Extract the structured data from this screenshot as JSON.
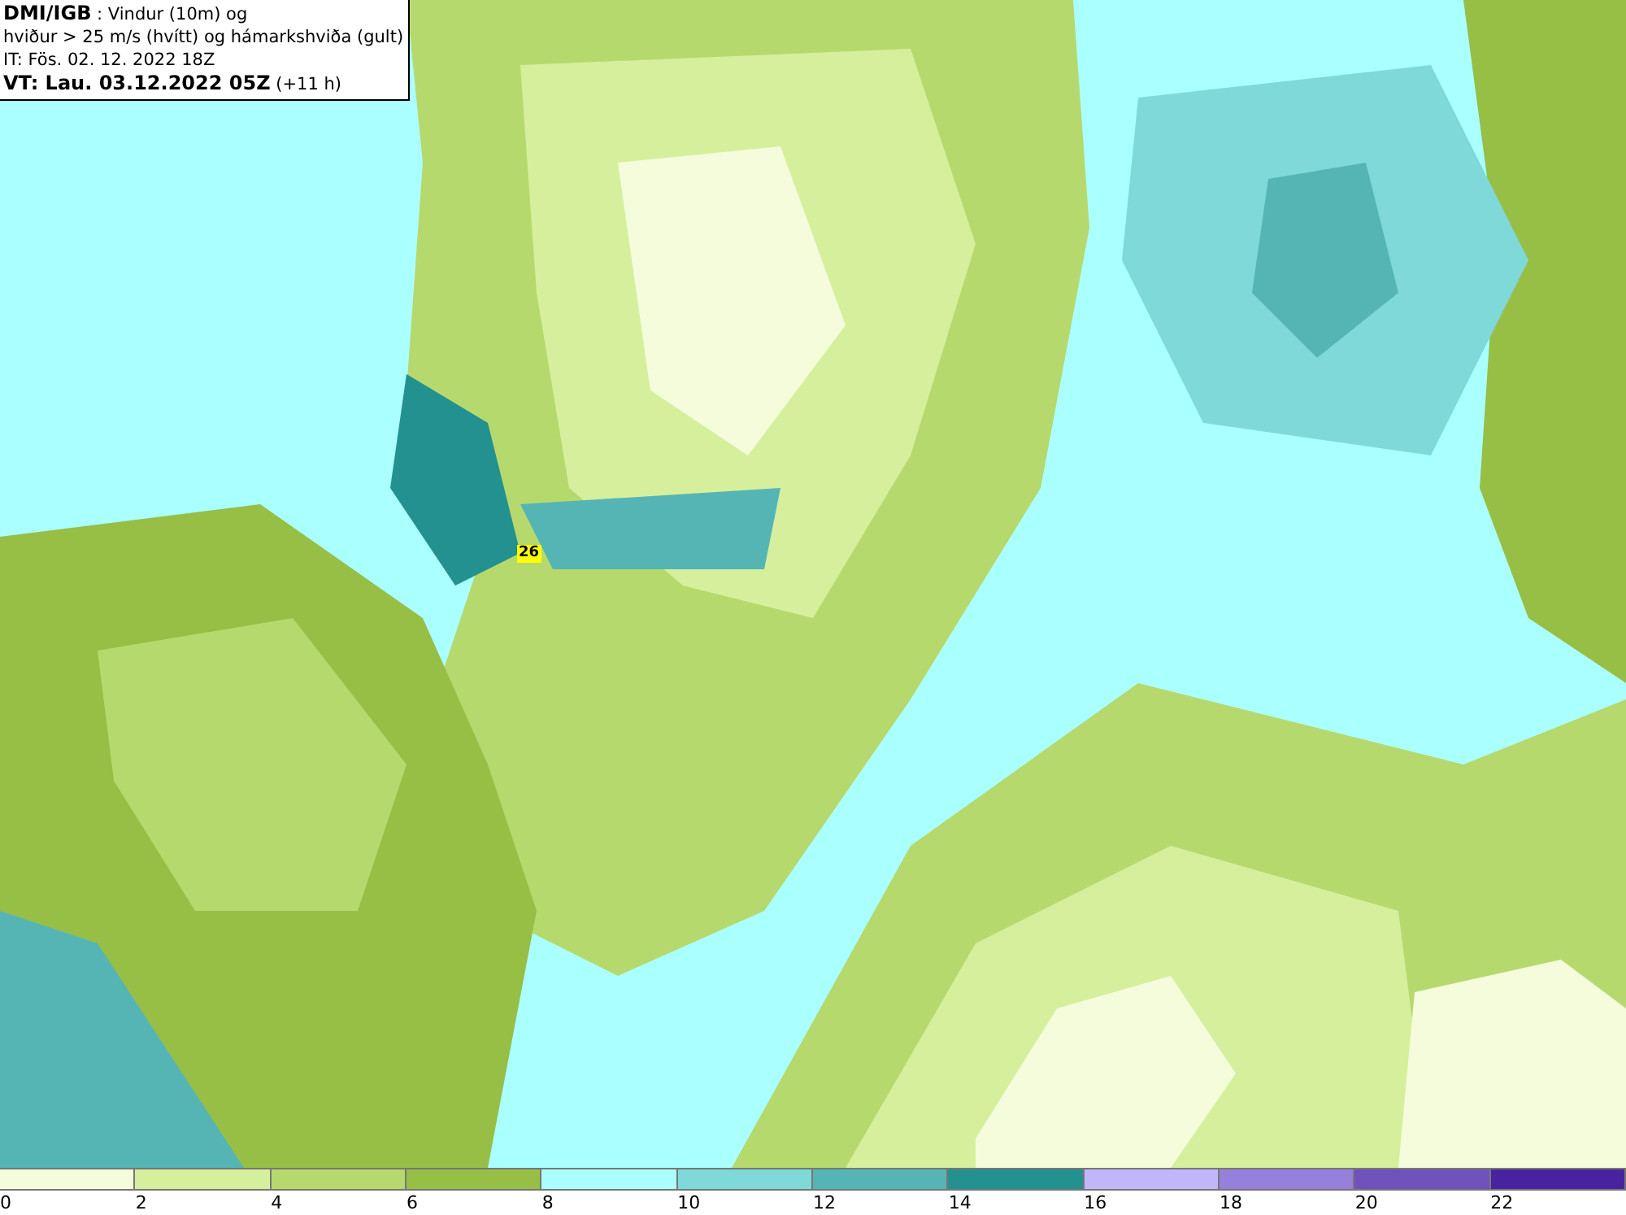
{
  "title_box": {
    "source": "DMI/IGB",
    "line_1": " : Vindur (10m) og",
    "line_2": "hviður > 25 m/s (hvítt) og hámarkshviða (gult)",
    "line_3": "IT: Fös. 02. 12. 2022 18Z",
    "line_4_bold": "VT: Lau. 03.12.2022 05Z",
    "line_4_rest": " (+11 h)"
  },
  "map": {
    "gust_label": "26"
  },
  "legend": [
    {
      "label": "0",
      "color": "#f5fcdc"
    },
    {
      "label": "2",
      "color": "#d6ef9c"
    },
    {
      "label": "4",
      "color": "#b6d96e"
    },
    {
      "label": "6",
      "color": "#97bf45"
    },
    {
      "label": "8",
      "color": "#aaffff"
    },
    {
      "label": "10",
      "color": "#7fd9d9"
    },
    {
      "label": "12",
      "color": "#55b5b5"
    },
    {
      "label": "14",
      "color": "#23918f"
    },
    {
      "label": "16",
      "color": "#c1b6fb"
    },
    {
      "label": "18",
      "color": "#9780db"
    },
    {
      "label": "20",
      "color": "#7152bd"
    },
    {
      "label": "22",
      "color": "#4723a0"
    }
  ]
}
